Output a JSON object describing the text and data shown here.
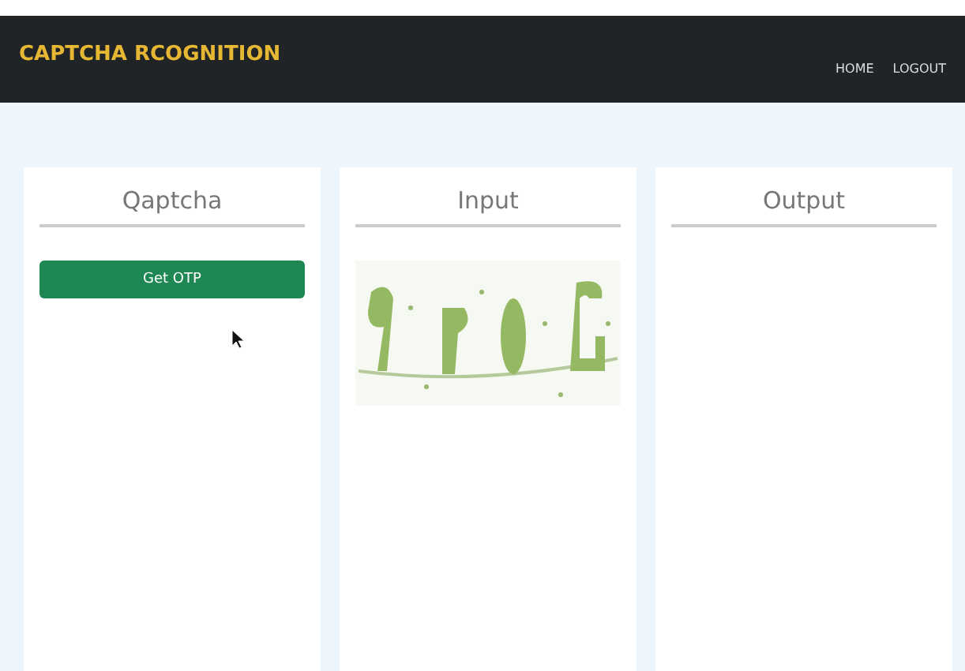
{
  "header": {
    "brand": "CAPTCHA RCOGNITION",
    "nav": [
      "HOME",
      "LOGOUT"
    ]
  },
  "panels": [
    {
      "title": "Qaptcha",
      "kind": "button",
      "button": "Get OTP"
    },
    {
      "title": "Input",
      "kind": "picture"
    },
    {
      "title": "Output",
      "kind": "empty"
    }
  ]
}
